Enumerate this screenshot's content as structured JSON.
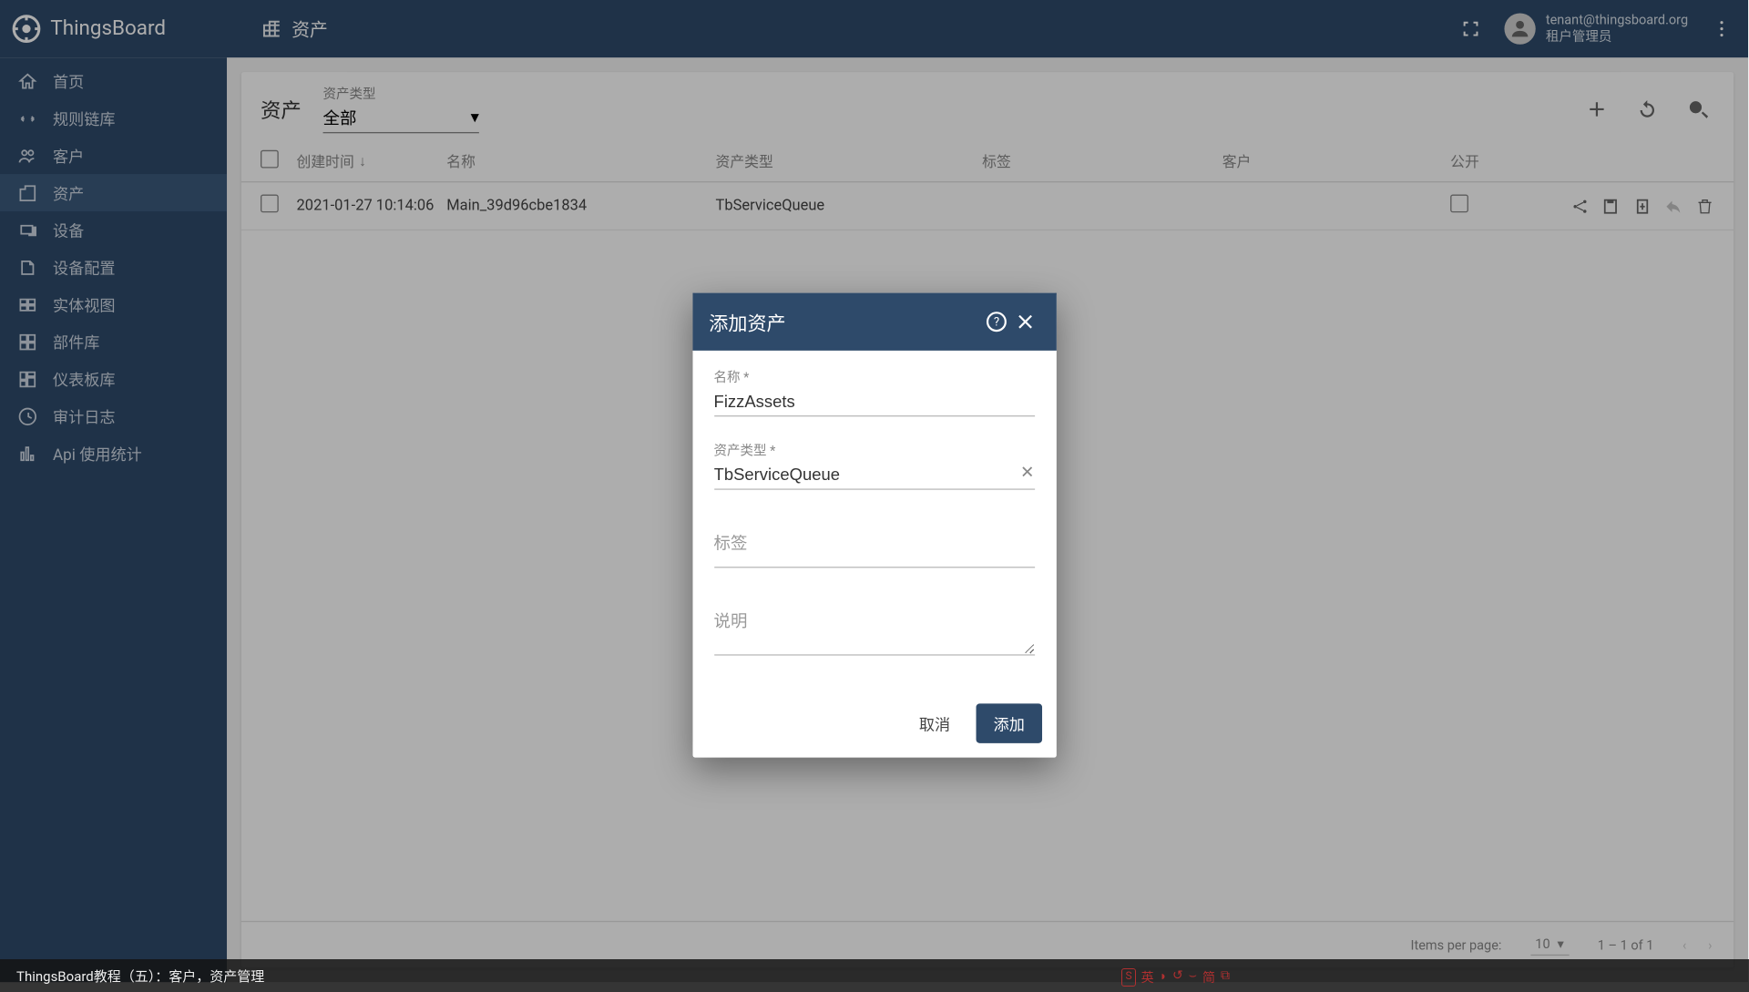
{
  "brand": "ThingsBoard",
  "breadcrumb": {
    "label": "资产"
  },
  "user": {
    "email": "tenant@thingsboard.org",
    "role": "租户管理员"
  },
  "sidebar": {
    "items": [
      {
        "label": "首页",
        "icon": "home"
      },
      {
        "label": "规则链库",
        "icon": "rule"
      },
      {
        "label": "客户",
        "icon": "people"
      },
      {
        "label": "资产",
        "icon": "domain",
        "active": true
      },
      {
        "label": "设备",
        "icon": "devices"
      },
      {
        "label": "设备配置",
        "icon": "profile"
      },
      {
        "label": "实体视图",
        "icon": "view"
      },
      {
        "label": "部件库",
        "icon": "widgets"
      },
      {
        "label": "仪表板库",
        "icon": "dashboard"
      },
      {
        "label": "审计日志",
        "icon": "audit"
      },
      {
        "label": "Api 使用统计",
        "icon": "stats"
      }
    ]
  },
  "card": {
    "title": "资产",
    "typeFilter": {
      "label": "资产类型",
      "value": "全部"
    },
    "columns": {
      "time": "创建时间",
      "name": "名称",
      "type": "资产类型",
      "label": "标签",
      "customer": "客户",
      "public": "公开"
    },
    "rows": [
      {
        "time": "2021-01-27 10:14:06",
        "name": "Main_39d96cbe1834",
        "type": "TbServiceQueue",
        "label": "",
        "customer": "",
        "public": false
      }
    ]
  },
  "paginator": {
    "itemsPerPageLabel": "Items per page:",
    "pageSize": "10",
    "range": "1 – 1 of 1"
  },
  "dialog": {
    "title": "添加资产",
    "fields": {
      "nameLabel": "名称 *",
      "nameValue": "FizzAssets",
      "typeLabel": "资产类型 *",
      "typeValue": "TbServiceQueue",
      "labelLabel": "标签",
      "descLabel": "说明"
    },
    "actions": {
      "cancel": "取消",
      "add": "添加"
    }
  },
  "caption": "ThingsBoard教程（五）：客户，资产管理",
  "ime": {
    "state": "英",
    "mode": "简"
  }
}
